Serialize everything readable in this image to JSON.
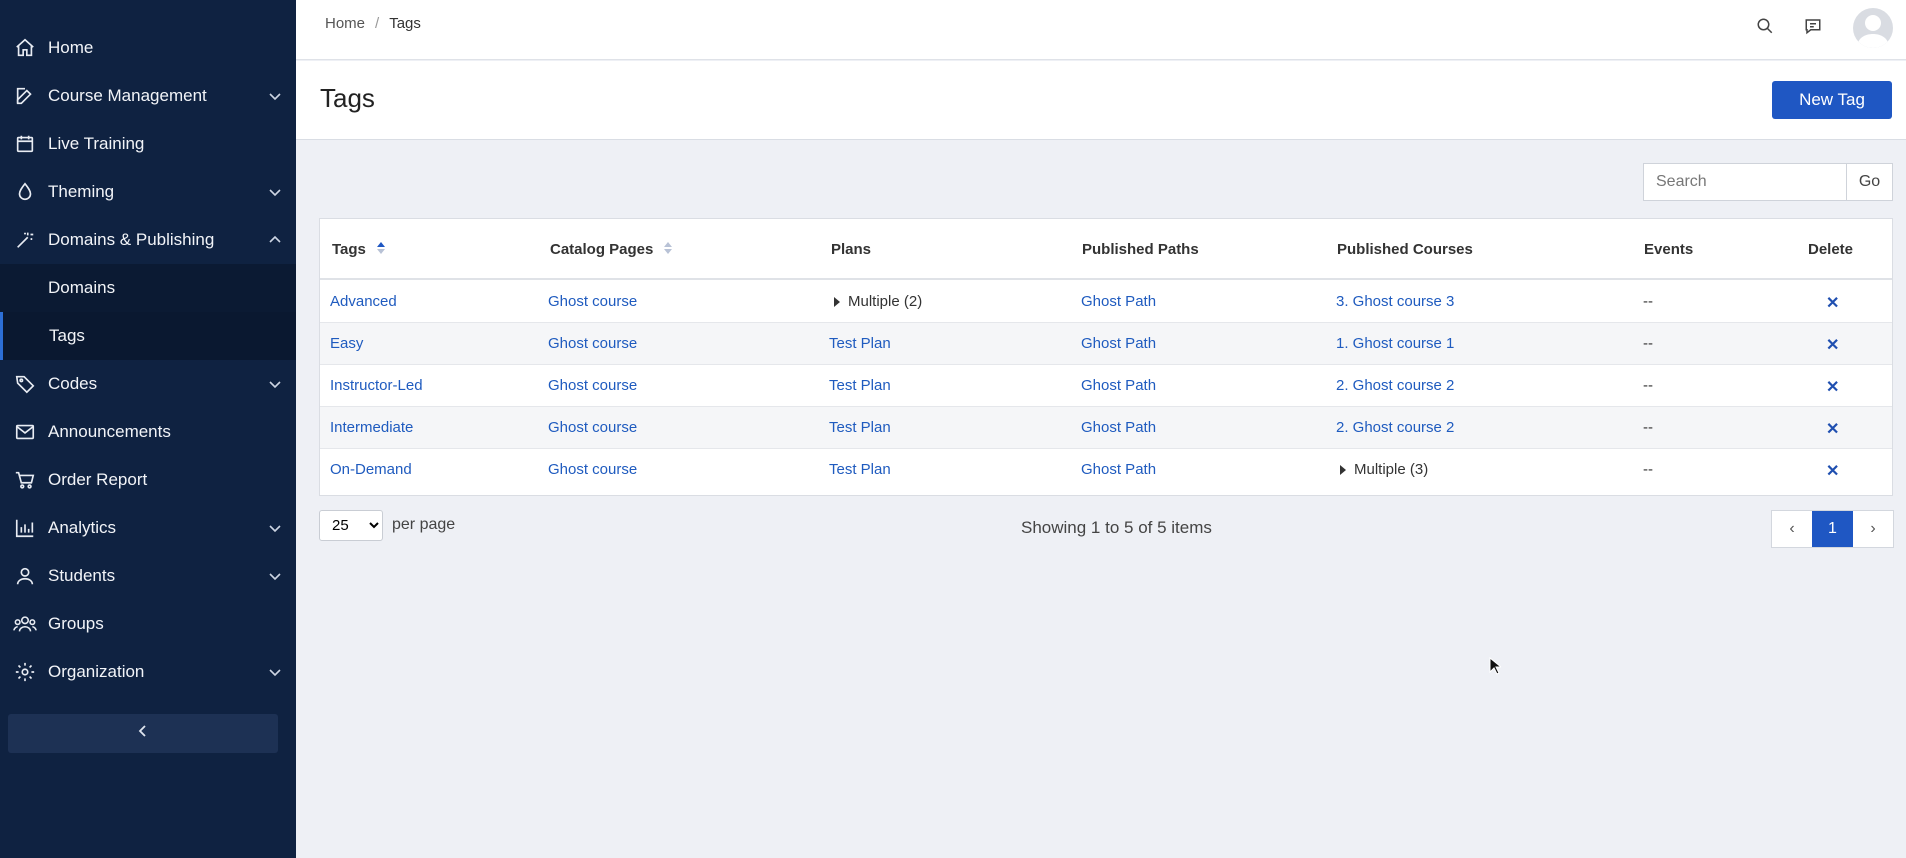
{
  "sidebar": {
    "items": [
      {
        "label": "Home",
        "icon": "home-icon"
      },
      {
        "label": "Course Management",
        "icon": "edit-icon",
        "expandable": true
      },
      {
        "label": "Live Training",
        "icon": "calendar-icon"
      },
      {
        "label": "Theming",
        "icon": "droplet-icon",
        "expandable": true
      },
      {
        "label": "Domains & Publishing",
        "icon": "magic-wand-icon",
        "expandable": true,
        "expanded": true
      },
      {
        "label": "Domains",
        "sub": true
      },
      {
        "label": "Tags",
        "sub": true,
        "active": true
      },
      {
        "label": "Codes",
        "icon": "tag-icon",
        "expandable": true
      },
      {
        "label": "Announcements",
        "icon": "mail-icon"
      },
      {
        "label": "Order Report",
        "icon": "cart-icon"
      },
      {
        "label": "Analytics",
        "icon": "bar-chart-icon",
        "expandable": true
      },
      {
        "label": "Students",
        "icon": "user-icon",
        "expandable": true
      },
      {
        "label": "Groups",
        "icon": "users-icon"
      },
      {
        "label": "Organization",
        "icon": "gear-icon",
        "expandable": true
      }
    ]
  },
  "breadcrumb": {
    "home": "Home",
    "separator": "/",
    "current": "Tags"
  },
  "page": {
    "title": "Tags",
    "new_button": "New Tag"
  },
  "search": {
    "placeholder": "Search",
    "go_label": "Go"
  },
  "table": {
    "columns": [
      "Tags",
      "Catalog Pages",
      "Plans",
      "Published Paths",
      "Published Courses",
      "Events",
      "Delete"
    ],
    "rows": [
      {
        "tag": "Advanced",
        "catalog": "Ghost course",
        "plans": "Multiple (2)",
        "plans_multi": true,
        "paths": "Ghost Path",
        "courses": "3. Ghost course 3",
        "courses_multi": false,
        "events": "--"
      },
      {
        "tag": "Easy",
        "catalog": "Ghost course",
        "plans": "Test Plan",
        "plans_multi": false,
        "paths": "Ghost Path",
        "courses": "1. Ghost course 1",
        "courses_multi": false,
        "events": "--"
      },
      {
        "tag": "Instructor-Led",
        "catalog": "Ghost course",
        "plans": "Test Plan",
        "plans_multi": false,
        "paths": "Ghost Path",
        "courses": "2. Ghost course 2",
        "courses_multi": false,
        "events": "--"
      },
      {
        "tag": "Intermediate",
        "catalog": "Ghost course",
        "plans": "Test Plan",
        "plans_multi": false,
        "paths": "Ghost Path",
        "courses": "2. Ghost course 2",
        "courses_multi": false,
        "events": "--"
      },
      {
        "tag": "On-Demand",
        "catalog": "Ghost course",
        "plans": "Test Plan",
        "plans_multi": false,
        "paths": "Ghost Path",
        "courses": "Multiple (3)",
        "courses_multi": true,
        "events": "--"
      }
    ],
    "delete_glyph": "✕"
  },
  "footer": {
    "per_page_value": "25",
    "per_page_label": "per page",
    "showing": "Showing 1 to 5 of 5 items",
    "pager": {
      "prev": "‹",
      "current": "1",
      "next": "›"
    }
  },
  "colors": {
    "sidebar_bg": "#0f2241",
    "accent": "#1f57c3",
    "link": "#1f5bbf"
  }
}
